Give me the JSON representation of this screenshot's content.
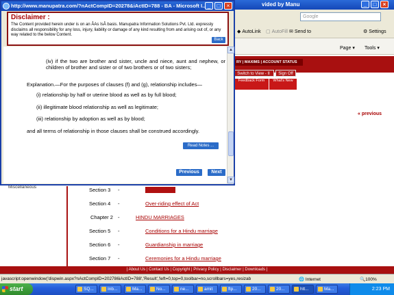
{
  "background_window": {
    "title": "vided by Manu",
    "search_placeholder": "Google",
    "toolbar": {
      "autolink": "AutoLink",
      "autofill": "AutoFill",
      "send_to": "Send to",
      "settings": "Settings",
      "page": "Page",
      "tools": "Tools"
    },
    "red_nav_text": "RY | MAXIMS | ACCOUNT STATUS",
    "switch_view": "Switch to View - II",
    "sign_off": "Sign Off",
    "feedback": "Feedback Form",
    "whats_new": "What's New",
    "previous_link": "previous",
    "sidebar_item": "Miscellaneous",
    "toc": [
      {
        "label": "Section 3",
        "dash": "-",
        "text": ""
      },
      {
        "label": "Section 4",
        "dash": "-",
        "text": "Over-riding effect of Act"
      },
      {
        "label": "Chapter 2",
        "dash": "-",
        "text": "HINDU MARRIAGES"
      },
      {
        "label": "Section 5",
        "dash": "-",
        "text": "Conditions for a Hindu marriage"
      },
      {
        "label": "Section 6",
        "dash": "-",
        "text": "Guardianship in marriage"
      },
      {
        "label": "Section 7",
        "dash": "-",
        "text": "Ceremonies for a Hindu marriage"
      }
    ],
    "footer_links": "| About Us | Contact Us | Copyright | Privacy Policy | Disclaimer | Downloads |"
  },
  "status_bar": {
    "url": "javascript:openwindow('dispwin.aspx?nActCompID=202786iActID=788','Result','left=0,top=0,toolbar=no,scrollbars=yes,resizab",
    "zone": "Internet",
    "zoom": "100%"
  },
  "taskbar": {
    "start": "start",
    "buttons": [
      "SQ...",
      "Inb...",
      "Ma...",
      "No...",
      "ne...",
      "amit",
      "ftp...",
      "20...",
      "20...",
      "htt...",
      "Ma..."
    ],
    "clock": "2:23 PM"
  },
  "popup": {
    "title": "http://www.manupatra.com/?nActCompID=20278&iActID=788 - BA - Microsoft I...",
    "disclaimer": {
      "title": "Disclaimer :",
      "body": "The Content provided herein under is on an ÂAs IsÂ basis. Manupatra Information Solutions Pvt. Ltd. expressly disclaims all responsibility for any loss, injury, liability or damage of any kind resulting from and arising out of, or any way related to the below Content.",
      "back": "Back"
    },
    "content": {
      "clause_iv": "(iv) if the two are brother and sister, uncle and niece, aunt and nephew, or children of brother and sister or of two brothers or of two sisters;",
      "explanation": "Explanation.—For the purposes of clauses (f) and (g), relationship includes—",
      "item_i": "(i) relationship by half or uterine blood as well as by full blood;",
      "item_ii": "(ii) illegitimate blood relationship as well as legitimate;",
      "item_iii": "(iii) relationship by adoption as well as by blood;",
      "closing": "and all terms of relationship in those clauses shall be construed accordingly.",
      "read_notes": "Read Notes ...",
      "previous": "Previous",
      "next": "Next"
    }
  }
}
